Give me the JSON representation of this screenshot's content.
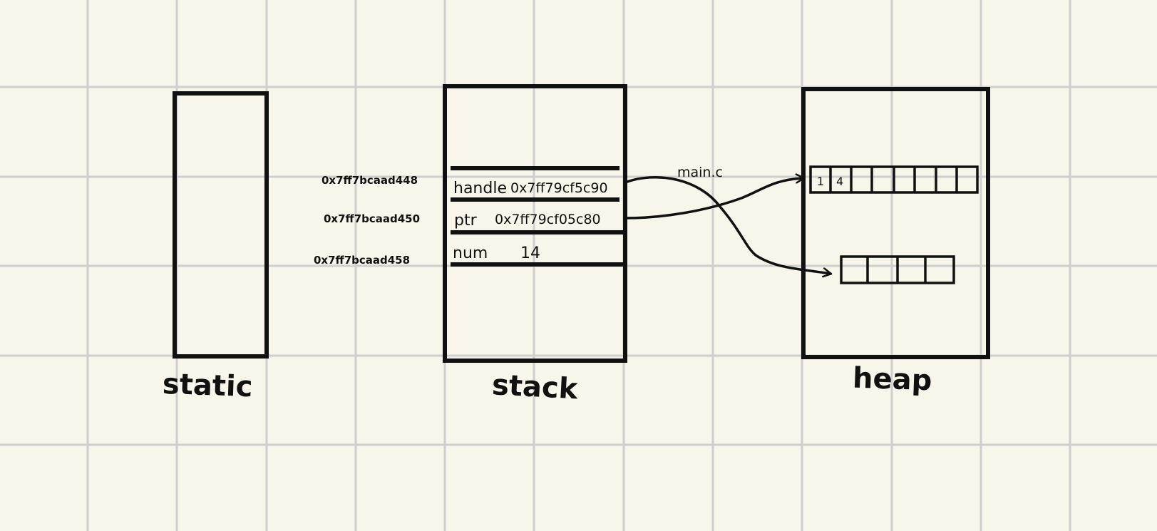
{
  "diagram": {
    "regions": {
      "static": "static",
      "stack": "stack",
      "heap": "heap"
    },
    "file_label": "main.c",
    "stack_frame": [
      {
        "address": "0x7ff7bcaad448",
        "name": "handle",
        "value": "0x7ff79cf5c90"
      },
      {
        "address": "0x7ff7bcaad450",
        "name": "ptr",
        "value": "0x7ff79cf05c80"
      },
      {
        "address": "0x7ff7bcaad458",
        "name": "num",
        "value": "14"
      }
    ],
    "heap_blocks": [
      {
        "cells": [
          "1",
          "4",
          "",
          "",
          "",
          "",
          "",
          ""
        ]
      },
      {
        "cells": [
          "",
          "",
          "",
          ""
        ]
      }
    ],
    "colors": {
      "paper": "#f8f6ea",
      "grid": "#cfcfcf",
      "ink": "#111111"
    }
  }
}
